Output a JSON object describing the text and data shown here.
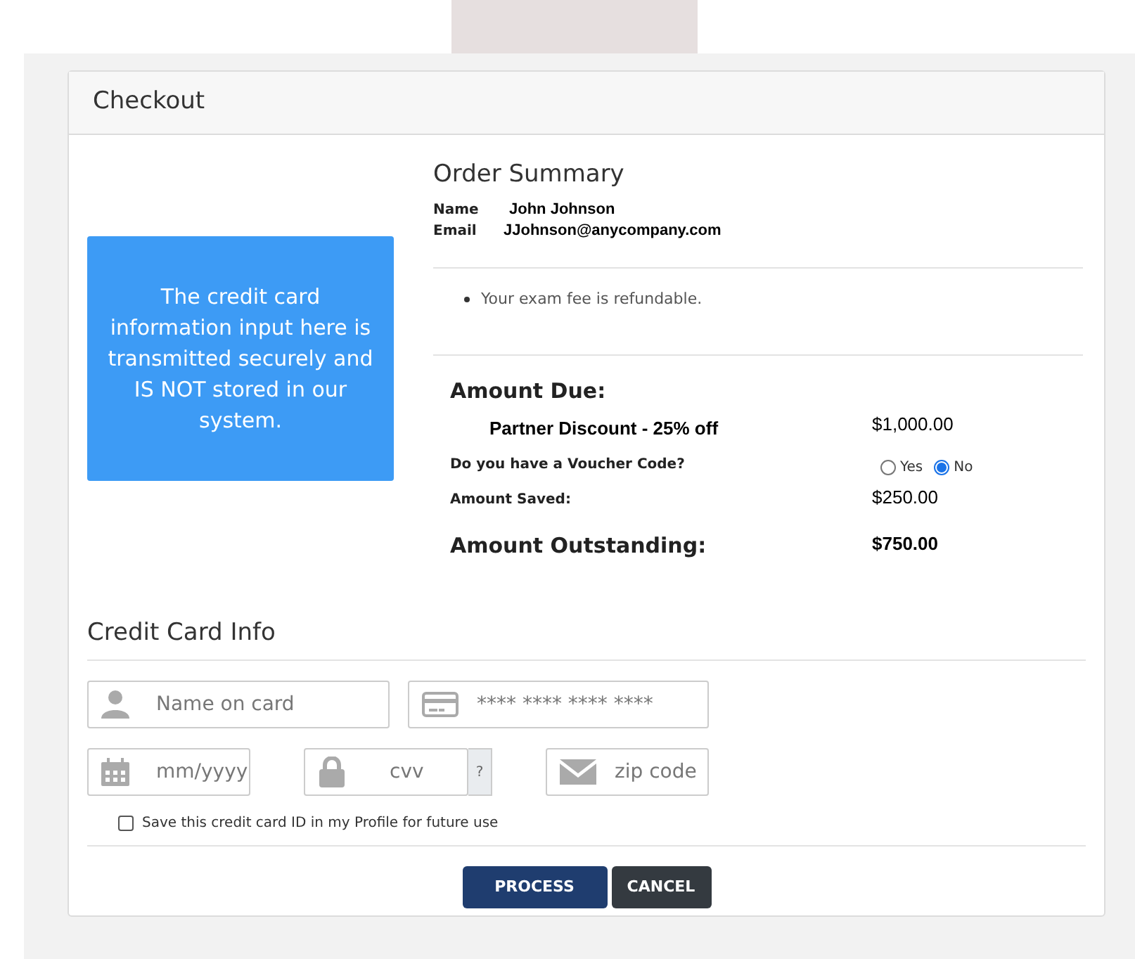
{
  "panel": {
    "title": "Checkout"
  },
  "notice": "The credit card information input here is transmitted securely and IS NOT stored in our system.",
  "order_summary": {
    "title": "Order Summary",
    "details": [
      {
        "label": "Name",
        "value": "John Johnson"
      },
      {
        "label": "Email",
        "value": "JJohnson@anycompany.com"
      }
    ],
    "notes": [
      "Your exam fee is refundable."
    ]
  },
  "amount": {
    "title": "Amount Due:",
    "discount_label": "Partner Discount - 25% off",
    "discount_value": "$1,000.00",
    "voucher_question": "Do you have a Voucher Code?",
    "voucher_options": [
      {
        "label": "Yes",
        "selected": false
      },
      {
        "label": "No",
        "selected": true
      }
    ],
    "saved_label": "Amount Saved:",
    "saved_value": "$250.00",
    "outstanding_label": "Amount Outstanding:",
    "outstanding_value": "$750.00"
  },
  "credit_card": {
    "title": "Credit Card Info",
    "fields": [
      {
        "kind": "name",
        "placeholder": "Name on card"
      },
      {
        "kind": "number",
        "placeholder": "**** **** **** ****"
      },
      {
        "kind": "expiry",
        "placeholder": "mm/yyyy"
      },
      {
        "kind": "cvv",
        "placeholder": "cvv",
        "help": "?"
      },
      {
        "kind": "zip",
        "placeholder": "zip code"
      }
    ],
    "save_option": {
      "label": "Save this credit card ID in my Profile for future use",
      "checked": false
    }
  },
  "buttons": [
    {
      "kind": "primary",
      "label": "PROCESS"
    },
    {
      "kind": "secondary",
      "label": "CANCEL"
    }
  ]
}
